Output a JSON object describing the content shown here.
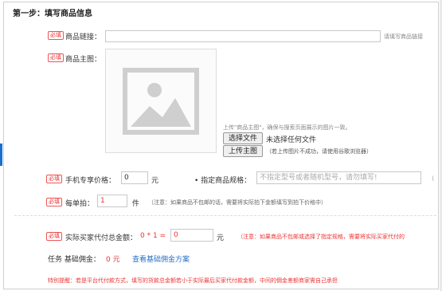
{
  "step_title": "第一步：填写商品信息",
  "required_tag": "必填",
  "product_link": {
    "label": "商品链接：",
    "value": "",
    "hint": "请填写商品链接"
  },
  "main_image": {
    "label": "商品主图：",
    "hint": "上传\"商品主图\"，确保与搜索页面展示的图片一致。",
    "choose_file_button": "选择文件",
    "no_file_text": "未选择任何文件",
    "upload_button": "上传主图",
    "upload_hint": "（若上传图片不成功，请使用谷歌浏览器）"
  },
  "mobile_price": {
    "label": "手机专享价格：",
    "value": "0",
    "unit": "元"
  },
  "spec": {
    "label": "• 指定商品规格：",
    "placeholder": "不指定型号或者随机型号，请勿填写!",
    "trailing": "（"
  },
  "per_order": {
    "label": "每单拍：",
    "value": "1",
    "unit": "件",
    "note": "（注意：如果商品不包邮的话，需要将实际拍下金额填写到拍下价格中）"
  },
  "total": {
    "label": "实际买家代付总金额：",
    "formula": "0 * 1 =",
    "value": "0",
    "unit": "元",
    "note": "（注意：如果商品不包邮或选择了指定规格，需要将实际买家代付的"
  },
  "commission": {
    "label": "任务 基础佣金：",
    "value": "0 元",
    "link": "查看基础佣金方案"
  },
  "notice": "特别提醒：若是平台代付款方式，填写的货款总金额若小于实际最后买家代付款金额，中间的佣金差额商家需自己承担",
  "colors": {
    "accent_red": "#e33333",
    "link_blue": "#2a73c8"
  }
}
